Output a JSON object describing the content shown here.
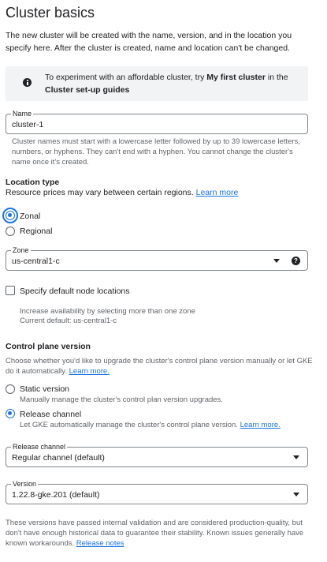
{
  "page": {
    "title": "Cluster basics",
    "intro": "The new cluster will be created with the name, version, and in the location you specify here. After the cluster is created, name and location can't be changed."
  },
  "info": {
    "prefix": "To experiment with an affordable cluster, try ",
    "bold1": "My first cluster",
    "middle": " in the ",
    "bold2": "Cluster set-up guides"
  },
  "name_field": {
    "label": "Name",
    "value": "cluster-1",
    "hint": "Cluster names must start with a lowercase letter followed by up to 39 lowercase letters, numbers, or hyphens. They can't end with a hyphen. You cannot change the cluster's name once it's created."
  },
  "location_type": {
    "heading": "Location type",
    "description": "Resource prices may vary between certain regions.",
    "learn_more": "Learn more",
    "options": [
      {
        "label": "Zonal",
        "selected": true
      },
      {
        "label": "Regional",
        "selected": false
      }
    ]
  },
  "zone_field": {
    "label": "Zone",
    "value": "us-central1-c",
    "help_glyph": "?"
  },
  "default_node_locations": {
    "label": "Specify default node locations",
    "checked": false,
    "hint1": "Increase availability by selecting more than one zone",
    "hint2": "Current default: us-central1-c"
  },
  "control_plane": {
    "heading": "Control plane version",
    "description": "Choose whether you'd like to upgrade the cluster's control plane version manually or let GKE do it automatically.",
    "learn_more": "Learn more.",
    "static": {
      "label": "Static version",
      "description": "Manually manage the cluster's control plan version upgrades.",
      "selected": false
    },
    "release": {
      "label": "Release channel",
      "description": "Let GKE automatically manage the cluster's control plane version.",
      "learn_more": "Learn more.",
      "selected": true
    }
  },
  "release_channel_field": {
    "label": "Release channel",
    "value": "Regular channel (default)"
  },
  "version_field": {
    "label": "Version",
    "value": "1.22.8-gke.201 (default)"
  },
  "footer": {
    "text": "These versions have passed internal validation and are considered production-quality, but don't have enough historical data to guarantee their stability. Known issues generally have known workarounds.",
    "link": "Release notes"
  },
  "colors": {
    "accent": "#1a73e8",
    "info_bg": "#f1f3f4",
    "border": "#80868b"
  }
}
